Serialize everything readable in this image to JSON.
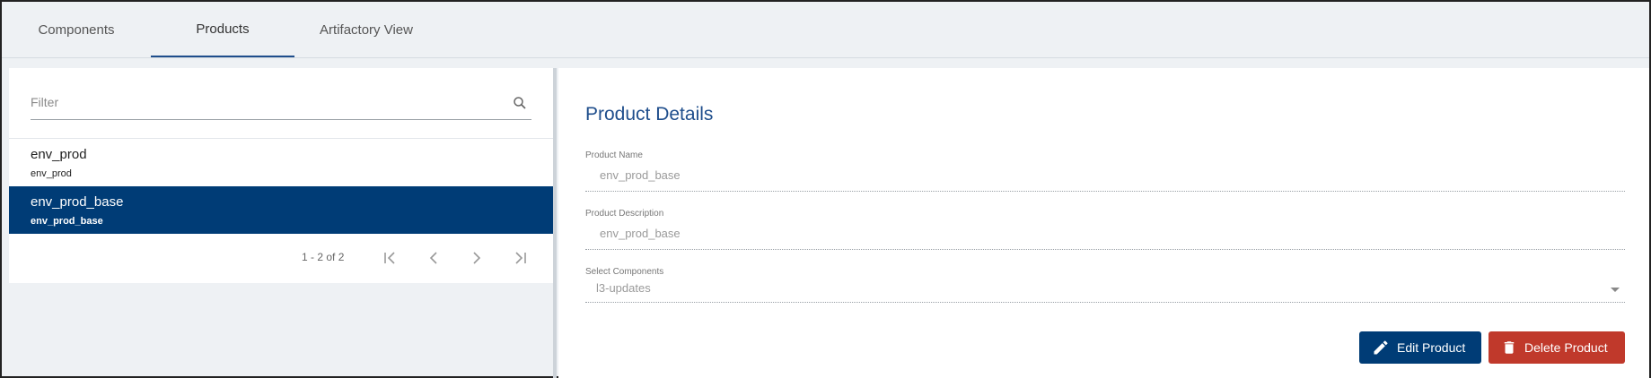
{
  "tabs": [
    {
      "label": "Components"
    },
    {
      "label": "Products"
    },
    {
      "label": "Artifactory View"
    }
  ],
  "active_tab": "Products",
  "filter": {
    "placeholder": "Filter",
    "value": ""
  },
  "products": [
    {
      "name": "env_prod",
      "description": "env_prod",
      "selected": false
    },
    {
      "name": "env_prod_base",
      "description": "env_prod_base",
      "selected": true
    }
  ],
  "paginator": {
    "range": "1 - 2 of 2"
  },
  "details": {
    "title": "Product Details",
    "product_name_label": "Product Name",
    "product_name_value": "env_prod_base",
    "product_description_label": "Product Description",
    "product_description_value": "env_prod_base",
    "select_components_label": "Select Components",
    "select_components_value": "l3-updates"
  },
  "actions": {
    "edit_label": "Edit Product",
    "delete_label": "Delete Product"
  },
  "colors": {
    "primary": "#003c76",
    "title": "#1f4e8c",
    "danger": "#c0392b"
  },
  "icons": [
    "search-icon",
    "first-page-icon",
    "prev-page-icon",
    "next-page-icon",
    "last-page-icon",
    "dropdown-arrow-icon",
    "pencil-icon",
    "trash-icon"
  ]
}
